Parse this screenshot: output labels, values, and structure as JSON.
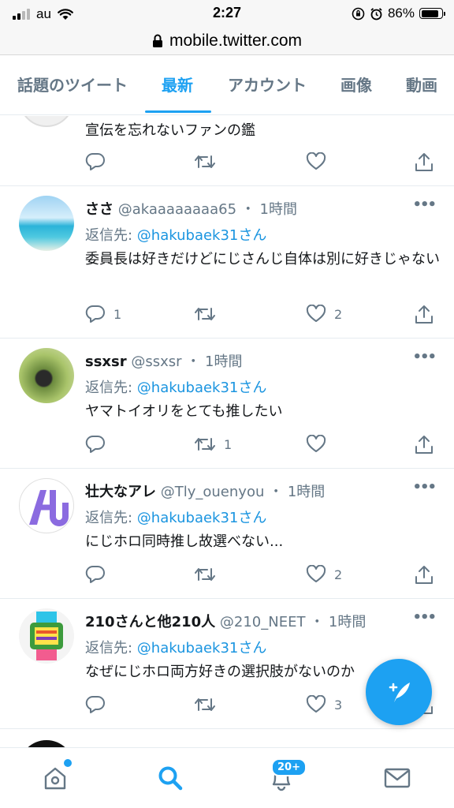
{
  "status_bar": {
    "carrier": "au",
    "time": "2:27",
    "battery": "86%"
  },
  "url_bar": {
    "url": "mobile.twitter.com"
  },
  "tabs": [
    {
      "label": "話題のツイート",
      "active": false
    },
    {
      "label": "最新",
      "active": true
    },
    {
      "label": "アカウント",
      "active": false
    },
    {
      "label": "画像",
      "active": false
    },
    {
      "label": "動画",
      "active": false
    }
  ],
  "tweets": [
    {
      "text": "宣伝を忘れないファンの鑑",
      "reply_count": "",
      "retweet_count": "",
      "like_count": ""
    },
    {
      "name": "ささ",
      "handle": "@akaaaaaaaa65",
      "dot": "・",
      "time": "1時間",
      "reply_prefix": "返信先: ",
      "reply_to": "@hakubaek31さん",
      "text": "委員長は好きだけどにじさんじ自体は別に好きじゃない",
      "reply_count": "1",
      "retweet_count": "",
      "like_count": "2"
    },
    {
      "name": "ssxsr",
      "handle": "@ssxsr",
      "dot": "・",
      "time": "1時間",
      "reply_prefix": "返信先: ",
      "reply_to": "@hakubaek31さん",
      "text": "ヤマトイオリをとても推したい",
      "reply_count": "",
      "retweet_count": "1",
      "like_count": ""
    },
    {
      "name": "壮大なアレ",
      "handle": "@Tly_ouenyou",
      "dot": "・",
      "time": "1時間",
      "reply_prefix": "返信先: ",
      "reply_to": "@hakubaek31さん",
      "text": "にじホロ同時推し故選べない...",
      "reply_count": "",
      "retweet_count": "",
      "like_count": "2"
    },
    {
      "name": "210さんと他210人",
      "handle": "@210_NEET",
      "dot": "・",
      "time": "1時間",
      "reply_prefix": "返信先: ",
      "reply_to": "@hakubaek31さん",
      "text": "なぜにじホロ両方好きの選択肢がないのか",
      "reply_count": "",
      "retweet_count": "",
      "like_count": "3"
    }
  ],
  "bottom_nav": {
    "notifications_badge": "20+"
  },
  "colors": {
    "accent": "#1da1f2",
    "secondary_text": "#657786",
    "primary_text": "#14171a"
  },
  "icons": [
    "home-icon",
    "search-icon",
    "bell-icon",
    "mail-icon",
    "compose-icon",
    "reply-icon",
    "retweet-icon",
    "like-icon",
    "share-icon",
    "more-icon",
    "lock-icon"
  ]
}
